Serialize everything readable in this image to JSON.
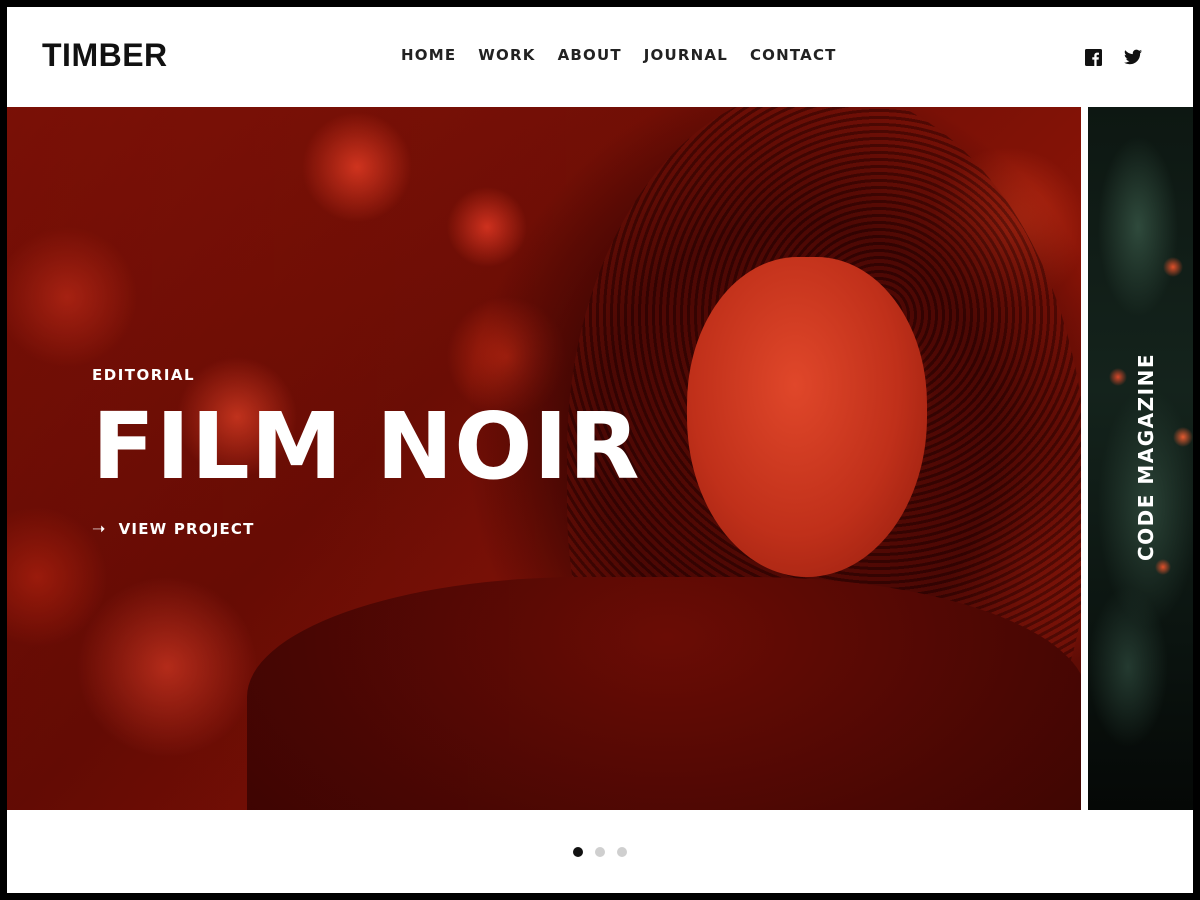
{
  "header": {
    "logo": "TIMBER",
    "nav": [
      "HOME",
      "WORK",
      "ABOUT",
      "JOURNAL",
      "CONTACT"
    ],
    "social_icons": [
      "facebook-icon",
      "twitter-icon"
    ]
  },
  "slider": {
    "current": {
      "category": "EDITORIAL",
      "title": "FILM NOIR",
      "link_label": "VIEW PROJECT",
      "tint_color": "#b0200f"
    },
    "next": {
      "title": "CODE MAGAZINE"
    },
    "pagination": {
      "total": 3,
      "active_index": 0
    }
  },
  "colors": {
    "frame": "#000000",
    "background": "#ffffff",
    "text": "#111111",
    "dot_inactive": "#cfcfcf",
    "dot_active": "#111111"
  }
}
